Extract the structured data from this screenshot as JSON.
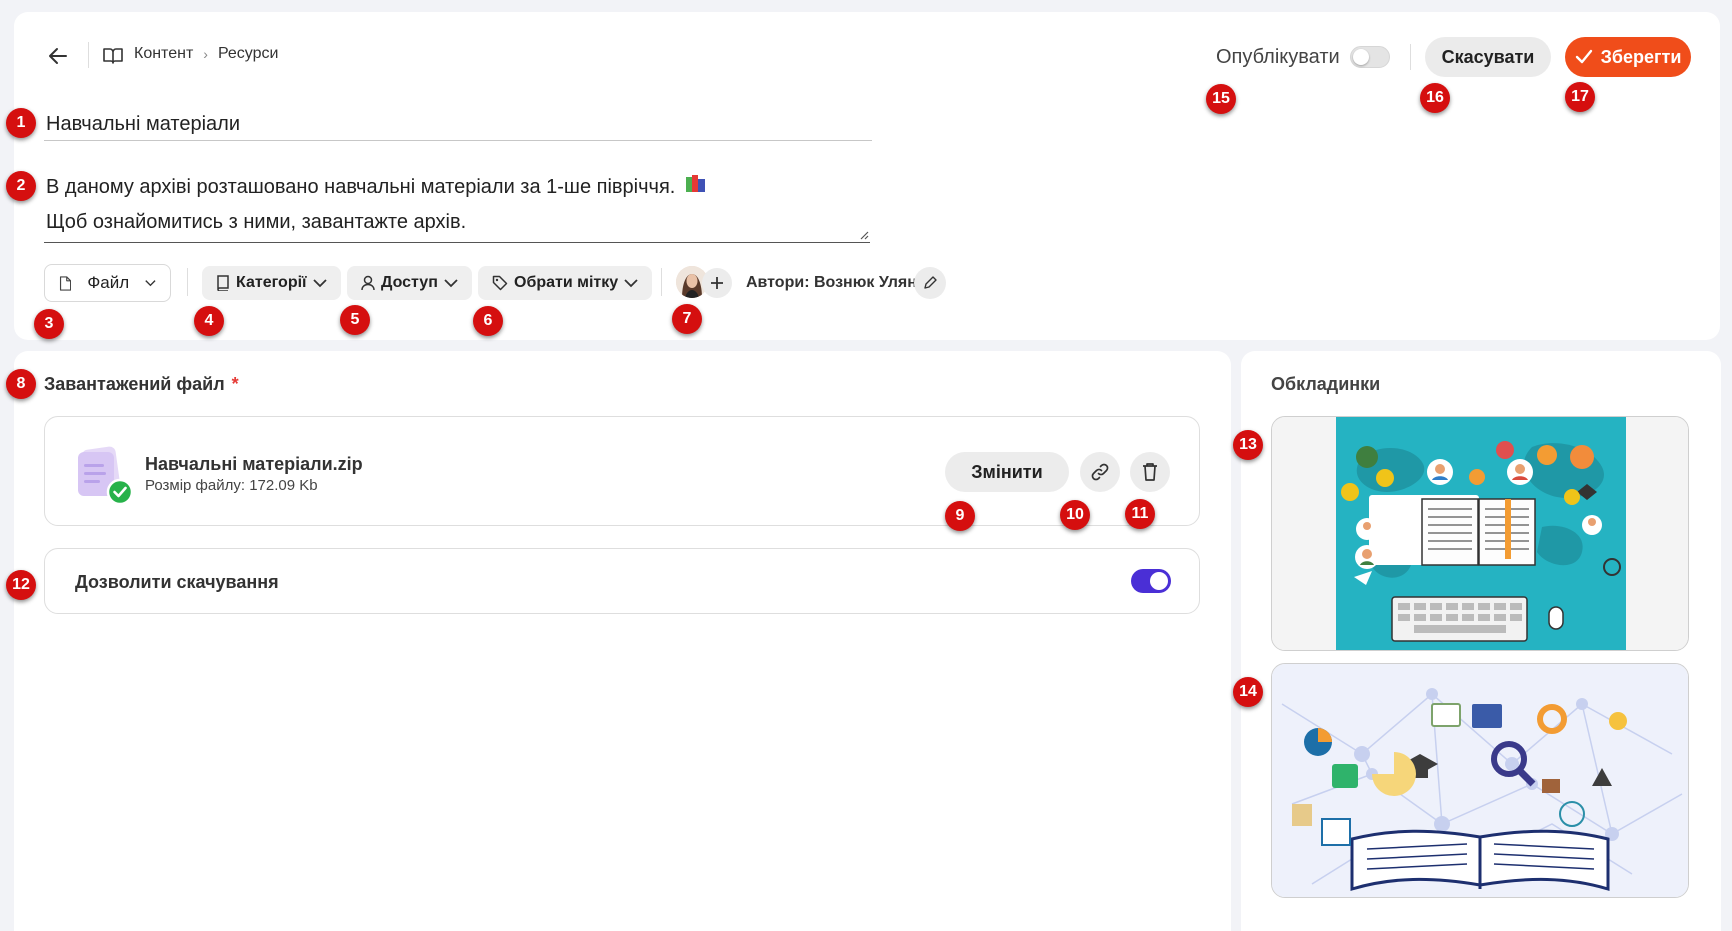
{
  "breadcrumb": {
    "root": "Контент",
    "current": "Ресурси"
  },
  "resource": {
    "title": "Навчальні матеріали",
    "description_line1": "В даному архіві розташовано навчальні матеріали за 1-ше півріччя.",
    "description_line2": "Щоб ознайомитись з ними, завантажте архів."
  },
  "header_actions": {
    "publish_label": "Опублікувати",
    "publish_on": false,
    "cancel_label": "Скасувати",
    "save_label": "Зберегти"
  },
  "toolbar": {
    "type_label": "Файл",
    "categories_label": "Категорії",
    "access_label": "Доступ",
    "tag_label": "Обрати мітку",
    "authors_label": "Автори: Вознюк Уляна"
  },
  "upload": {
    "section_title": "Завантажений файл",
    "required_mark": "*",
    "file_name": "Навчальні матеріали.zip",
    "file_size": "Розмір файлу: 172.09 Kb",
    "change_label": "Змінити",
    "allow_download_label": "Дозволити скачування",
    "allow_download": true
  },
  "covers": {
    "title": "Обкладинки",
    "count": 2
  },
  "badges": {
    "title": "1",
    "description": "2",
    "type": "3",
    "categories": "4",
    "access": "5",
    "tag": "6",
    "authors": "7",
    "uploaded": "8",
    "change": "9",
    "link": "10",
    "delete": "11",
    "allow": "12",
    "cover1": "13",
    "cover2": "14",
    "publish": "15",
    "cancel": "16",
    "save": "17"
  },
  "colors": {
    "accent": "#f04d1a",
    "toggle_on": "#4a2fd6",
    "badge": "#d50f0f",
    "success": "#27b24a"
  }
}
